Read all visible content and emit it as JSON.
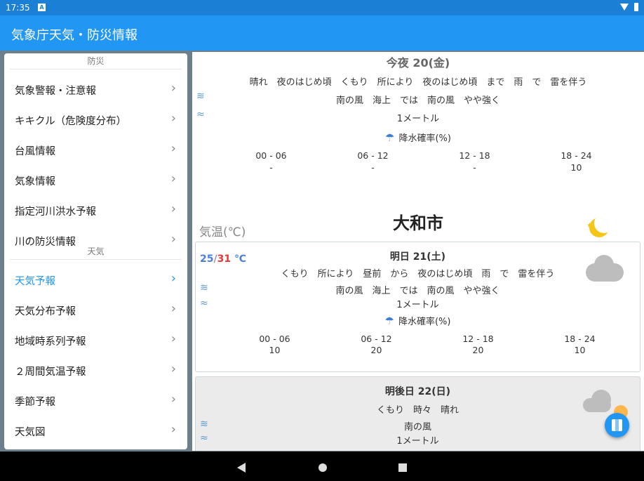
{
  "status": {
    "time": "17:35",
    "notif": "A"
  },
  "app": {
    "title": "気象庁天気・防災情報"
  },
  "drawer": {
    "section_disaster": "防災",
    "disaster_items": [
      "気象警報・注意報",
      "キキクル（危険度分布）",
      "台風情報",
      "気象情報",
      "指定河川洪水予報",
      "川の防災情報"
    ],
    "section_weather": "天気",
    "weather_items": [
      "天気予報",
      "天気分布予報",
      "地域時系列予報",
      "２周間気温予報",
      "季節予報",
      "天気図"
    ],
    "active_item": "天気予報",
    "chevron": "›"
  },
  "tonight": {
    "head": "今夜 20(金)",
    "weather": "晴れ　夜のはじめ頃　くもり　所により　夜のはじめ頃　まで　雨　で　雷を伴う",
    "wind": "南の風　海上　では　南の風　やや強く",
    "wave": "1メートル",
    "rain_label": "降水確率(%)",
    "periods": [
      "00 - 06",
      "06 - 12",
      "12 - 18",
      "18 - 24"
    ],
    "probs": [
      "-",
      "-",
      "-",
      "10"
    ]
  },
  "location": {
    "name": "大和市",
    "temp_label": "気温(℃)"
  },
  "tomorrow": {
    "head": "明日 21(土)",
    "temp_low": "25",
    "temp_sep": "/",
    "temp_high": "31",
    "temp_unit": " ℃",
    "weather": "くもり　所により　昼前　から　夜のはじめ頃　雨　で　雷を伴う",
    "wind": "南の風　海上　では　南の風　やや強く",
    "wave": "1メートル",
    "rain_label": "降水確率(%)",
    "periods": [
      "00 - 06",
      "06 - 12",
      "12 - 18",
      "18 - 24"
    ],
    "probs": [
      "10",
      "20",
      "20",
      "10"
    ]
  },
  "dayafter": {
    "head": "明後日 22(日)",
    "weather": "くもり　時々　晴れ",
    "wind": "南の風",
    "wave": "1メートル"
  },
  "icons": {
    "wind": "wind-icon",
    "wave": "wave-icon",
    "umbrella": "umbrella-icon",
    "map": "map-icon"
  },
  "colors": {
    "appbar": "#2196f3",
    "statusbar": "#1b7fd6",
    "accent": "#2196f3",
    "temp_high": "#e53935",
    "temp_low": "#4a7fd6"
  }
}
